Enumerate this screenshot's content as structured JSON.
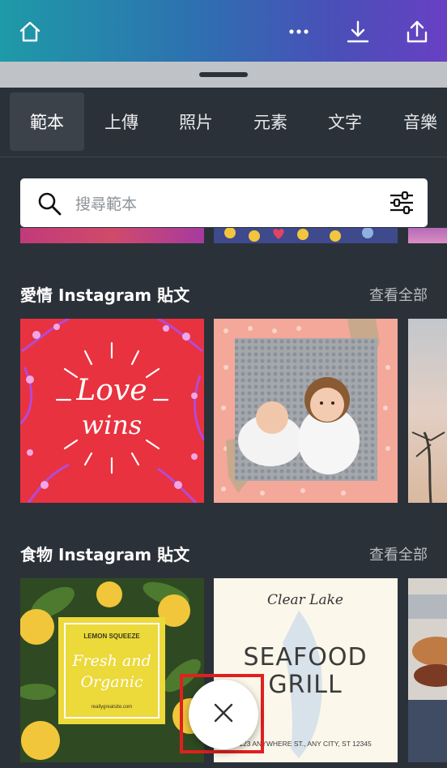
{
  "tabs": [
    {
      "label": "範本",
      "active": true
    },
    {
      "label": "上傳",
      "active": false
    },
    {
      "label": "照片",
      "active": false
    },
    {
      "label": "元素",
      "active": false
    },
    {
      "label": "文字",
      "active": false
    },
    {
      "label": "音樂",
      "active": false
    }
  ],
  "search": {
    "placeholder": "搜尋範本"
  },
  "sections": [
    {
      "title": "愛情 Instagram 貼文",
      "see_all": "查看全部"
    },
    {
      "title": "食物 Instagram 貼文",
      "see_all": "查看全部"
    }
  ],
  "cards": {
    "love": {
      "line1": "Love",
      "line2": "wins"
    },
    "organic": {
      "kicker": "LEMON SQUEEZE",
      "line1": "Fresh and",
      "line2": "Organic",
      "url": "reallygreatsite.com"
    },
    "seafood": {
      "script": "Clear Lake",
      "line1": "SEAFOOD",
      "line2": "GRILL",
      "address": "123 ANYWHERE ST., ANY CITY, ST 12345"
    }
  },
  "colors": {
    "background": "#2b3138",
    "topbar_start": "#1e9aa8",
    "topbar_end": "#6840c4",
    "highlight": "#e0201f"
  },
  "icons": [
    "home-icon",
    "more-icon",
    "download-icon",
    "share-icon",
    "search-icon",
    "filter-icon",
    "close-icon"
  ]
}
